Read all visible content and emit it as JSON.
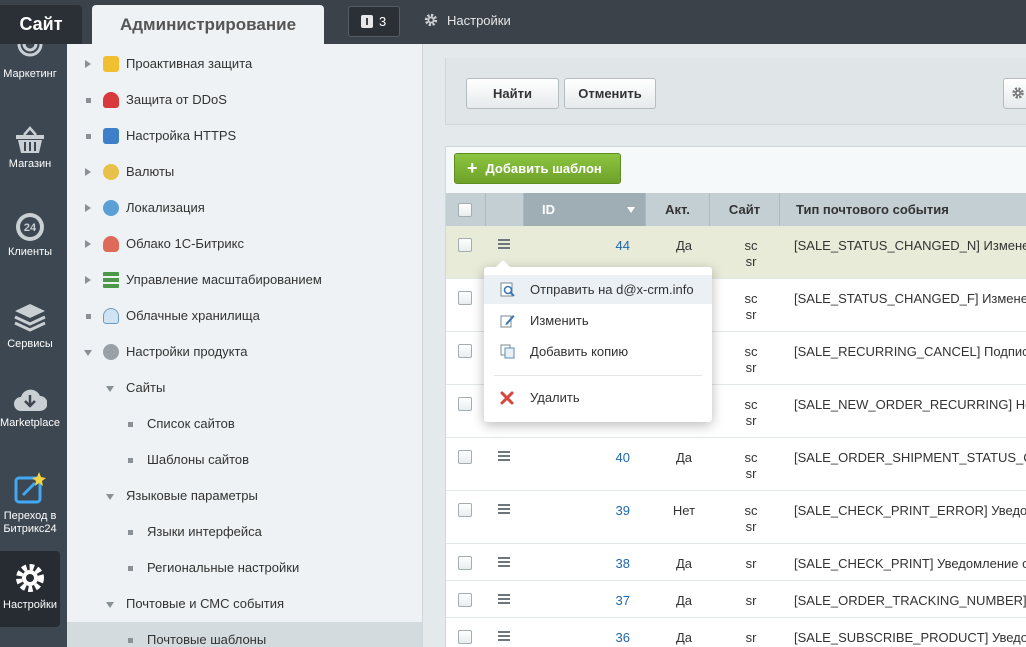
{
  "topbar": {
    "site_tab": "Сайт",
    "admin_tab": "Администрирование",
    "notifications_count": "3",
    "settings_label": "Настройки"
  },
  "rail": [
    {
      "label": "Маркетинг",
      "icon": "target-icon"
    },
    {
      "label": "Магазин",
      "icon": "basket-icon"
    },
    {
      "label": "Клиенты",
      "icon": "clients-24-icon"
    },
    {
      "label": "Сервисы",
      "icon": "layers-icon"
    },
    {
      "label": "Marketplace",
      "icon": "cloud-download-icon"
    },
    {
      "label_line1": "Переход в",
      "label_line2": "Битрикс24",
      "icon": "bitrix24-icon"
    },
    {
      "label": "Настройки",
      "icon": "gear-icon"
    }
  ],
  "menu": [
    {
      "label": "Проактивная защита",
      "marker": "arrow-right",
      "icon": "lock-icon"
    },
    {
      "label": "Защита от DDoS",
      "marker": "dot",
      "icon": "shield-icon"
    },
    {
      "label": "Настройка HTTPS",
      "marker": "dot",
      "icon": "https-icon"
    },
    {
      "label": "Валюты",
      "marker": "arrow-right",
      "icon": "currency-icon"
    },
    {
      "label": "Локализация",
      "marker": "arrow-right",
      "icon": "globe-icon"
    },
    {
      "label": "Облако 1С-Битрикс",
      "marker": "arrow-right",
      "icon": "cloud-icon"
    },
    {
      "label": "Управление масштабированием",
      "marker": "arrow-right",
      "icon": "servers-icon"
    },
    {
      "label": "Облачные хранилища",
      "marker": "dot",
      "icon": "storage-icon"
    },
    {
      "label": "Настройки продукта",
      "marker": "arrow-down",
      "icon": "gear-icon"
    },
    {
      "label": "Сайты",
      "marker": "arrow-down"
    },
    {
      "label": "Список сайтов",
      "marker": "dot"
    },
    {
      "label": "Шаблоны сайтов",
      "marker": "dot"
    },
    {
      "label": "Языковые параметры",
      "marker": "arrow-down"
    },
    {
      "label": "Языки интерфейса",
      "marker": "dot"
    },
    {
      "label": "Региональные настройки",
      "marker": "dot"
    },
    {
      "label": "Почтовые и СМС события",
      "marker": "arrow-down"
    },
    {
      "label": "Почтовые шаблоны",
      "marker": "dot"
    }
  ],
  "filter": {
    "find_button": "Найти",
    "cancel_button": "Отменить"
  },
  "table": {
    "add_button": "Добавить шаблон",
    "headers": {
      "id": "ID",
      "active": "Акт.",
      "site": "Сайт",
      "type": "Тип почтового события"
    },
    "rows": [
      {
        "id": "44",
        "active": "Да",
        "site1": "sc",
        "site2": "sr",
        "type": "[SALE_STATUS_CHANGED_N] Изменение"
      },
      {
        "id": "",
        "active": "",
        "site1": "sc",
        "site2": "sr",
        "type": "[SALE_STATUS_CHANGED_F] Изменение"
      },
      {
        "id": "",
        "active": "",
        "site1": "sc",
        "site2": "sr",
        "type": "[SALE_RECURRING_CANCEL] Подписка"
      },
      {
        "id": "",
        "active": "",
        "site1": "sc",
        "site2": "sr",
        "type": "[SALE_NEW_ORDER_RECURRING] Новый"
      },
      {
        "id": "40",
        "active": "Да",
        "site1": "sc",
        "site2": "sr",
        "type": "[SALE_ORDER_SHIPMENT_STATUS_CH"
      },
      {
        "id": "39",
        "active": "Нет",
        "site1": "sc",
        "site2": "sr",
        "type": "[SALE_CHECK_PRINT_ERROR] Уведомление"
      },
      {
        "id": "38",
        "active": "Да",
        "site1": "sr",
        "site2": "",
        "type": "[SALE_CHECK_PRINT] Уведомление о"
      },
      {
        "id": "37",
        "active": "Да",
        "site1": "sr",
        "site2": "",
        "type": "[SALE_ORDER_TRACKING_NUMBER] У"
      },
      {
        "id": "36",
        "active": "Да",
        "site1": "sr",
        "site2": "",
        "type": "[SALE_SUBSCRIBE_PRODUCT] Уведомление"
      }
    ]
  },
  "context_menu": {
    "send": "Отправить на d@x-crm.info",
    "edit": "Изменить",
    "copy": "Добавить копию",
    "delete": "Удалить"
  }
}
